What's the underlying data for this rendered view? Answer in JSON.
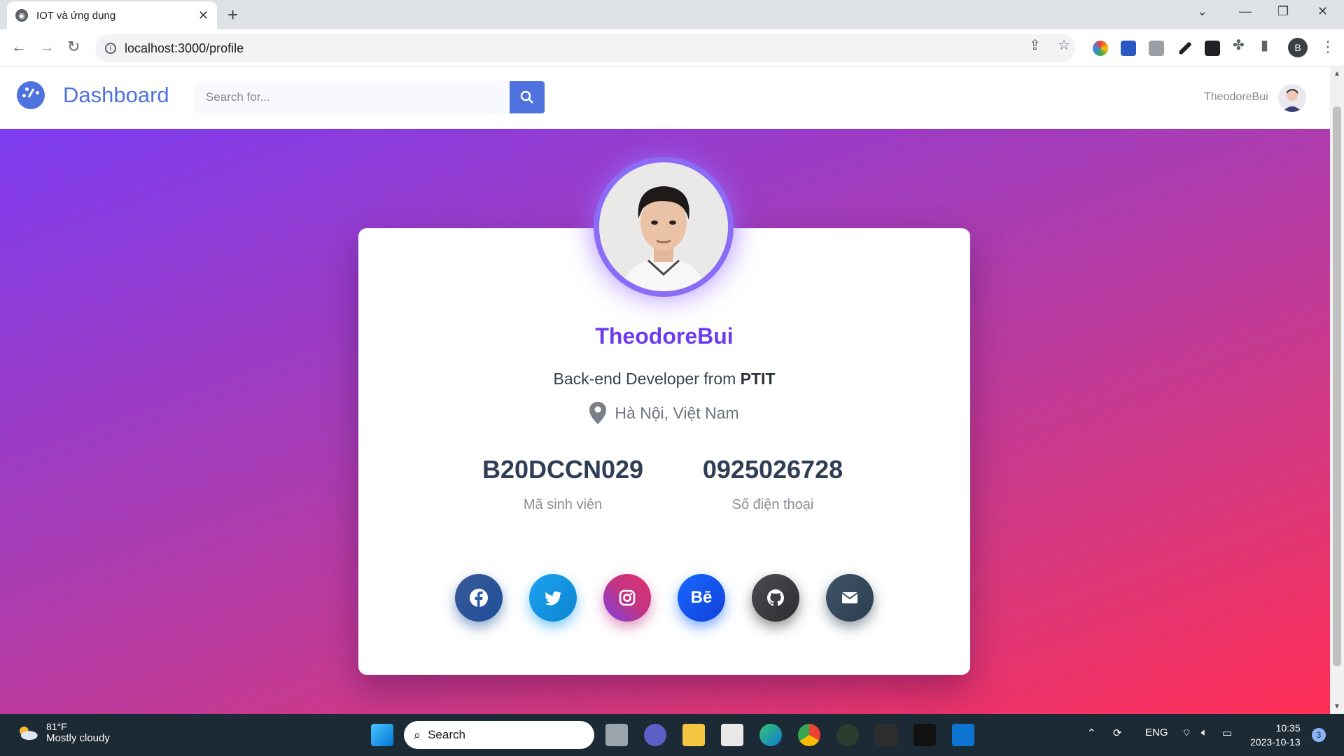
{
  "browser": {
    "tab_title": "IOT và ứng dụng",
    "url": "localhost:3000/profile"
  },
  "header": {
    "brand": "Dashboard",
    "search_placeholder": "Search for...",
    "username": "TheodoreBui"
  },
  "profile": {
    "name": "TheodoreBui",
    "role_prefix": "Back-end Developer from ",
    "role_org": "PTIT",
    "location": "Hà Nội, Việt Nam",
    "stats": [
      {
        "value": "B20DCCN029",
        "label": "Mã sinh viên"
      },
      {
        "value": "0925026728",
        "label": "Số điện thoại"
      }
    ],
    "socials": [
      {
        "name": "facebook",
        "color": "#2d5fa8"
      },
      {
        "name": "twitter",
        "color": "#1da1f2"
      },
      {
        "name": "instagram",
        "color": "#c13584"
      },
      {
        "name": "behance",
        "color": "#1652f0",
        "text": "Bē"
      },
      {
        "name": "github",
        "color": "#3d3f43"
      },
      {
        "name": "email",
        "color": "#34495e"
      }
    ]
  },
  "taskbar": {
    "temperature": "81°F",
    "weather": "Mostly cloudy",
    "search": "Search",
    "lang": "ENG",
    "time": "10:35",
    "date": "2023-10-13",
    "notifications": "3"
  },
  "colors": {
    "accent": "#4e73df",
    "name": "#6d3bf0"
  }
}
